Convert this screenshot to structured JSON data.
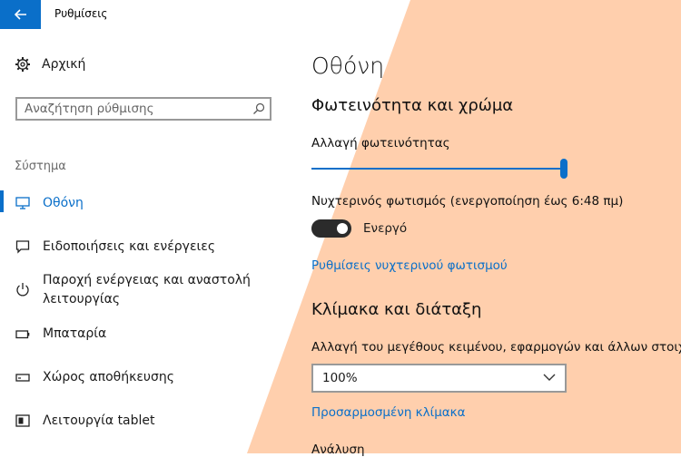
{
  "window": {
    "title": "Ρυθμίσεις"
  },
  "sidebar": {
    "home_label": "Αρχική",
    "search_placeholder": "Αναζήτηση ρύθμισης",
    "section_label": "Σύστημα",
    "items": [
      {
        "label": "Οθόνη",
        "icon": "monitor-icon",
        "selected": true
      },
      {
        "label": "Ειδοποιήσεις και ενέργειες",
        "icon": "notification-icon"
      },
      {
        "label_line1": "Παροχή ενέργειας και αναστολή",
        "label_line2": "λειτουργίας",
        "icon": "power-icon"
      },
      {
        "label": "Μπαταρία",
        "icon": "battery-icon"
      },
      {
        "label": "Χώρος αποθήκευσης",
        "icon": "storage-icon"
      },
      {
        "label": "Λειτουργία tablet",
        "icon": "tablet-mode-icon"
      }
    ]
  },
  "main": {
    "title": "Οθόνη",
    "brightness": {
      "heading": "Φωτεινότητα και χρώμα",
      "label": "Αλλαγή φωτεινότητας",
      "value_fraction": 1.0
    },
    "night_light": {
      "label": "Νυχτερινός φωτισμός (ενεργοποίηση έως 6:48 πμ)",
      "state_label": "Ενεργό",
      "on": true,
      "settings_link": "Ρυθμίσεις νυχτερινού φωτισμού"
    },
    "scale": {
      "heading": "Κλίμακα και διάταξη",
      "label": "Αλλαγή του μεγέθους κειμένου, εφαρμογών και άλλων στοιχ",
      "selected": "100%",
      "custom_link": "Προσαρμοσμένη κλίμακα",
      "resolution_label": "Ανάλυση"
    }
  },
  "colors": {
    "accent": "#0a6fc9",
    "night_light_tint": "#ffcfad"
  }
}
